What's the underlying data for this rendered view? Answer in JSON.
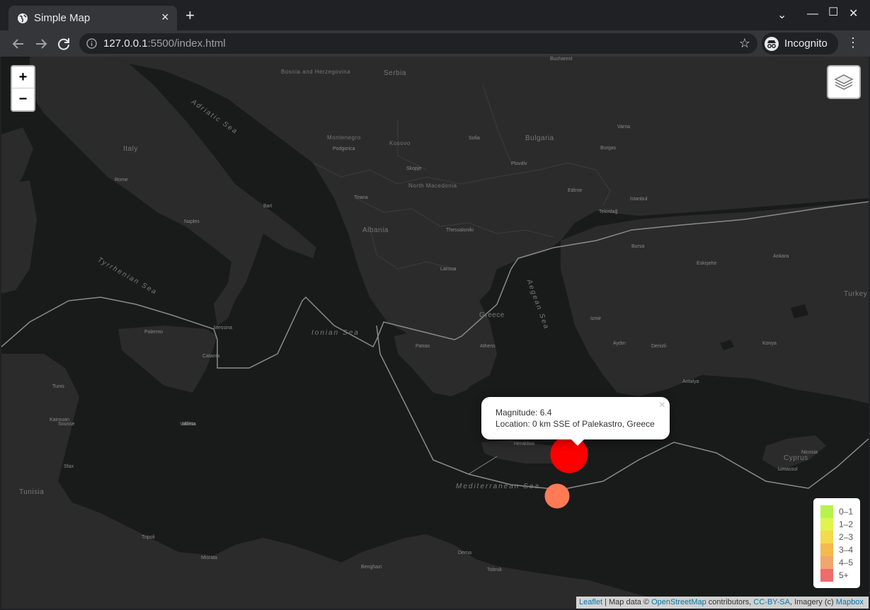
{
  "browser": {
    "tab_title": "Simple Map",
    "tab_close": "×",
    "new_tab": "+",
    "url_host": "127.0.0.1",
    "url_rest": ":5500/index.html",
    "profile_label": "Incognito",
    "window_controls": {
      "tab_search": "⌄",
      "minimize": "—",
      "maximize": "☐",
      "close": "✕"
    }
  },
  "map": {
    "zoom_in": "+",
    "zoom_out": "−",
    "popup": {
      "magnitude_line": "Magnitude: 6.4",
      "location_line": "Location: 0 km SSE of Palekastro, Greece",
      "close": "×"
    },
    "markers": [
      {
        "magnitude": 6.4,
        "color": "#ff0000"
      },
      {
        "color": "#ff7a55"
      }
    ],
    "legend": [
      {
        "label": "0–1",
        "color": "#b7f34d"
      },
      {
        "label": "1–2",
        "color": "#e1f34d"
      },
      {
        "label": "2–3",
        "color": "#f3db4d"
      },
      {
        "label": "3–4",
        "color": "#f3ba4d"
      },
      {
        "label": "4–5",
        "color": "#f0a76b"
      },
      {
        "label": "5+",
        "color": "#f06b6b"
      }
    ],
    "attribution": {
      "leaflet": "Leaflet",
      "text1": " | Map data © ",
      "osm": "OpenStreetMap",
      "text2": " contributors, ",
      "license": "CC-BY-SA",
      "text3": ", Imagery (c) ",
      "mapbox": "Mapbox"
    },
    "labels": {
      "countries": [
        "Italy",
        "Greece",
        "Bulgaria",
        "Serbia",
        "Albania",
        "North Macedonia",
        "Montenegro",
        "Kosovo",
        "Bosnia and Herzegovina",
        "Tunisia",
        "Cyprus",
        "Turkey"
      ],
      "seas": [
        "Adriatic Sea",
        "Tyrrhenian Sea",
        "Ionian Sea",
        "Aegean Sea",
        "Mediterranean Sea"
      ],
      "cities": [
        "Bucharest",
        "Rome",
        "Naples",
        "Bari",
        "Palermo",
        "Tunis",
        "Sofia",
        "Skopje",
        "Tirana",
        "Podgorica",
        "Athens",
        "Izmir",
        "Bursa",
        "Istanbul",
        "Antalya",
        "Tripoli",
        "Misrata",
        "Benghazi",
        "Valletta",
        "Sfax",
        "Kairouan",
        "Heraklion",
        "Catania",
        "Messina",
        "Konya",
        "Ankara",
        "Eskişehir",
        "Denizli",
        "Aydın",
        "Tekirdağ",
        "Patras",
        "Larissa",
        "Thessaloniki",
        "Plovdiv",
        "Burgas",
        "Varna",
        "Edirne",
        "Nicosia",
        "Limassol",
        "Sousse",
        "Derna",
        "Tobruk",
        "Mdina"
      ]
    }
  }
}
